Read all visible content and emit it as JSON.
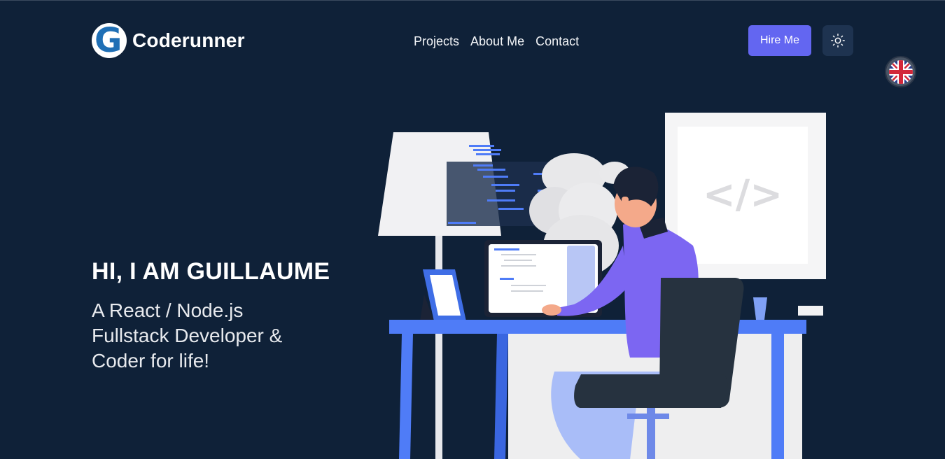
{
  "brand": {
    "logo_letter": "G",
    "name": "Coderunner"
  },
  "nav": {
    "items": [
      {
        "label": "Projects"
      },
      {
        "label": "About Me"
      },
      {
        "label": "Contact"
      }
    ]
  },
  "actions": {
    "hire_label": "Hire Me",
    "theme_icon": "sun-icon",
    "language_icon": "uk-flag-icon"
  },
  "hero": {
    "title": "HI, I AM GUILLAUME",
    "subtitle": "A React / Node.js\nFullstack Developer &\nCoder for life!"
  },
  "illustration": {
    "monitor_text": "</>"
  },
  "colors": {
    "background": "#0f2138",
    "accent": "#6366f1",
    "desk_blue": "#4f7cf7",
    "shirt": "#7c66f2"
  }
}
